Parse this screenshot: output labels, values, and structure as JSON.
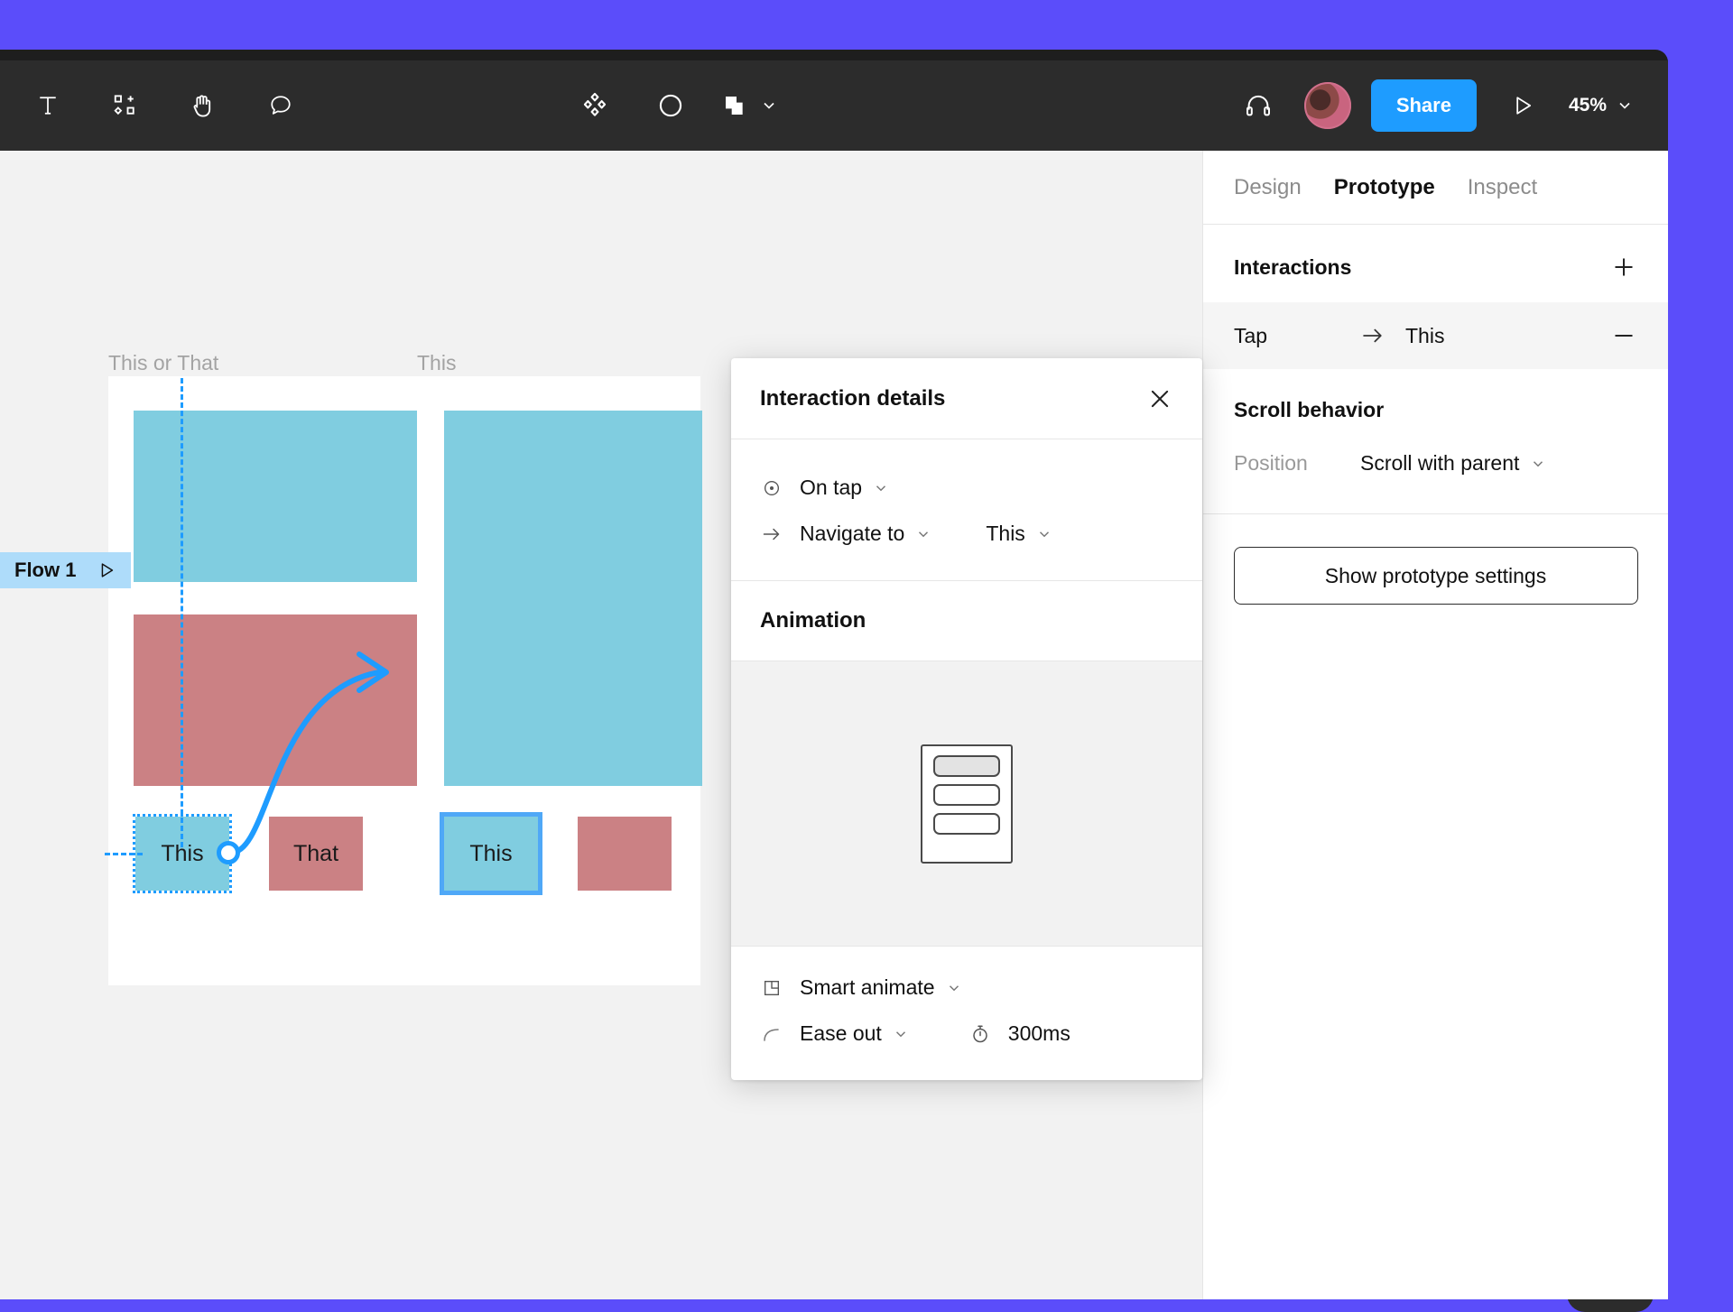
{
  "theme": {
    "desktop_bg": "#5B4DFA",
    "toolbar_bg": "#2C2C2C",
    "canvas_bg": "#F2F2F2",
    "accent_blue": "#1E9CFF",
    "flow_badge_bg": "#AEDCFA",
    "shape_teal": "#80CDE0",
    "shape_rose": "#CB8184"
  },
  "toolbar": {
    "left_tools": [
      {
        "name": "text-tool-icon",
        "label": "Text"
      },
      {
        "name": "components-tool-icon",
        "label": "Components"
      },
      {
        "name": "hand-tool-icon",
        "label": "Hand"
      },
      {
        "name": "comment-tool-icon",
        "label": "Comment"
      }
    ],
    "mid_tools": [
      {
        "name": "plugins-icon",
        "label": "Plugins"
      },
      {
        "name": "mask-icon",
        "label": "Mask"
      },
      {
        "name": "boolean-icon",
        "label": "Boolean groups"
      }
    ],
    "headphones_label": "Audio",
    "avatar_label": "User avatar",
    "share_label": "Share",
    "present_label": "Present",
    "zoom_level": "45%"
  },
  "canvas": {
    "flow_badge": {
      "label": "Flow 1",
      "play_label": "Play flow"
    },
    "frames": [
      {
        "label": "This or That",
        "buttons": [
          {
            "text": "This",
            "selected": true
          },
          {
            "text": "That",
            "selected": false
          }
        ]
      },
      {
        "label": "This",
        "buttons": [
          {
            "text": "This",
            "selected": true
          },
          {
            "text": "",
            "selected": false
          }
        ]
      }
    ]
  },
  "interaction_modal": {
    "title": "Interaction details",
    "close_label": "Close",
    "trigger": {
      "icon": "on-tap-icon",
      "value": "On tap"
    },
    "action": {
      "icon": "navigate-arrow-icon",
      "value": "Navigate to",
      "destination": "This"
    },
    "animation_title": "Animation",
    "preview_label": "Animation preview",
    "animation_type": "Smart animate",
    "easing": "Ease out",
    "duration": "300ms"
  },
  "right_panel": {
    "tabs": [
      {
        "label": "Design",
        "active": false
      },
      {
        "label": "Prototype",
        "active": true
      },
      {
        "label": "Inspect",
        "active": false
      }
    ],
    "interactions": {
      "title": "Interactions",
      "add_label": "Add interaction",
      "row": {
        "trigger": "Tap",
        "destination": "This",
        "remove_label": "Remove interaction"
      }
    },
    "scroll_behavior": {
      "title": "Scroll behavior",
      "position_label": "Position",
      "position_value": "Scroll with parent"
    },
    "show_prototype_settings_label": "Show prototype settings"
  }
}
